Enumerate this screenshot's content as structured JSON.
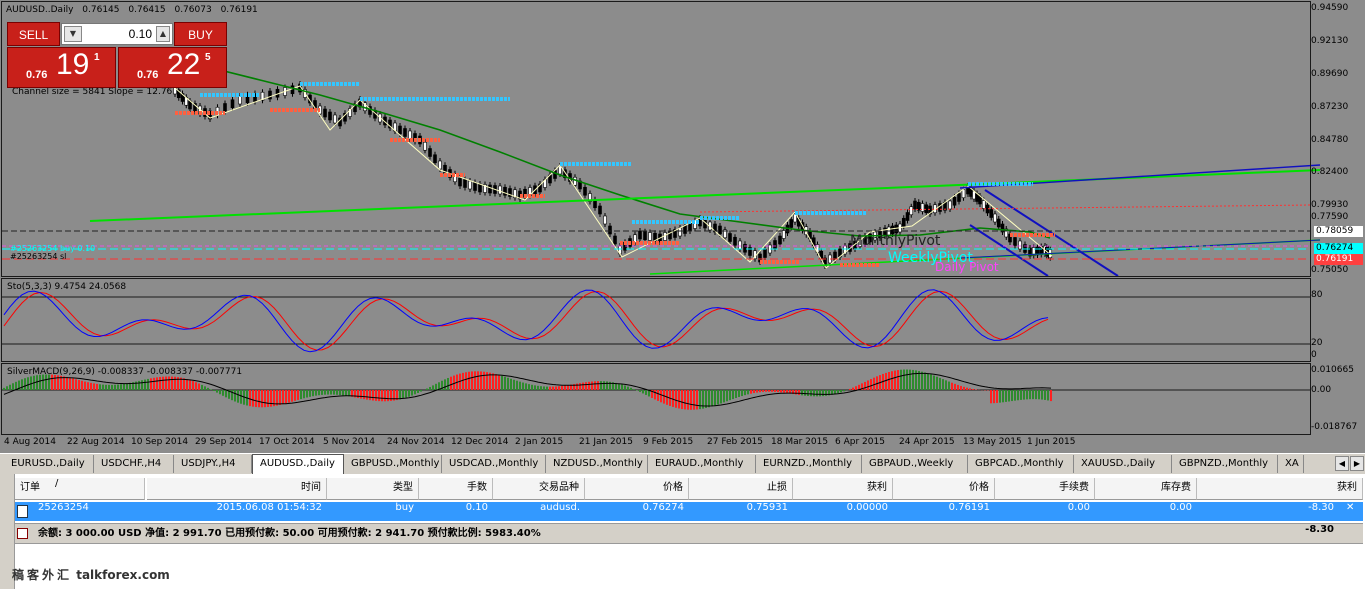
{
  "chart": {
    "symbol_label": "AUDUSD..Daily",
    "ohlc": [
      "0.76145",
      "0.76415",
      "0.76073",
      "0.76191"
    ],
    "channel_info": "Channel size = 5841  Slope = 12.76",
    "stoch_label": "Sto(5,3,3) 9.4754 24.0568",
    "macd_label": "SilverMACD(9,26,9) -0.008337 -0.008337 -0.007771",
    "order_line_1": "#25263254 buy 0.10",
    "order_line_2": "#25263254 sl",
    "pivot_monthly": "MonthlyPivot",
    "pivot_weekly": "WeeklyPivot",
    "pivot_daily": "Daily Pivot",
    "price_axis": [
      "0.94590",
      "0.92130",
      "0.89690",
      "0.87230",
      "0.84780",
      "0.82400",
      "0.79930",
      "0.77590",
      "0.75050"
    ],
    "price_tags": [
      {
        "label": "0.78059",
        "bg": "#ffffff",
        "fg": "#000000"
      },
      {
        "label": "0.76274",
        "bg": "#00ffff",
        "fg": "#000000"
      },
      {
        "label": "0.76191",
        "bg": "#ff4040",
        "fg": "#ffffff"
      }
    ],
    "stoch_axis": [
      "80",
      "20",
      "0"
    ],
    "macd_axis": [
      "0.010665",
      "0.00",
      "-0.018767"
    ],
    "date_axis": [
      "4 Aug 2014",
      "22 Aug 2014",
      "10 Sep 2014",
      "29 Sep 2014",
      "17 Oct 2014",
      "5 Nov 2014",
      "24 Nov 2014",
      "12 Dec 2014",
      "2 Jan 2015",
      "21 Jan 2015",
      "9 Feb 2015",
      "27 Feb 2015",
      "18 Mar 2015",
      "6 Apr 2015",
      "24 Apr 2015",
      "13 May 2015",
      "1 Jun 2015"
    ],
    "colors": {
      "bg": "#8c8c8c",
      "ma": "#008000",
      "channel": "#00e000",
      "resist": "#33c6ff",
      "support": "#ff6040",
      "macd_pos": "#2e8b2e",
      "macd_neg": "#ff2020",
      "stoch_k": "#0000ff",
      "stoch_d": "#ff0000",
      "bear_channel": "#1010c0"
    }
  },
  "trade_panel": {
    "sell_label": "SELL",
    "buy_label": "BUY",
    "lot": "0.10",
    "sell_small": "0.76",
    "sell_big": "19",
    "sell_sup": "1",
    "buy_small": "0.76",
    "buy_big": "22",
    "buy_sup": "5"
  },
  "tabs": [
    "EURUSD.,Daily",
    "USDCHF.,H4",
    "USDJPY.,H4",
    "AUDUSD.,Daily",
    "GBPUSD.,Monthly",
    "USDCAD.,Monthly",
    "NZDUSD.,Monthly",
    "EURAUD.,Monthly",
    "EURNZD.,Monthly",
    "GBPAUD.,Weekly",
    "GBPCAD.,Monthly",
    "XAUUSD.,Daily",
    "GBPNZD.,Monthly",
    "XA"
  ],
  "active_tab": "AUDUSD.,Daily",
  "terminal": {
    "headers": [
      "订单",
      "/",
      "时间",
      "类型",
      "手数",
      "交易品种",
      "价格",
      "止损",
      "获利",
      "价格",
      "手续费",
      "库存费",
      "获利"
    ],
    "order": {
      "ticket": "25263254",
      "time": "2015.06.08 01:54:32",
      "type": "buy",
      "lots": "0.10",
      "symbol": "audusd.",
      "open_price": "0.76274",
      "sl": "0.75931",
      "tp": "0.00000",
      "price": "0.76191",
      "commission": "0.00",
      "swap": "0.00",
      "profit": "-8.30"
    },
    "balance_line": "余额: 3 000.00 USD  净值: 2 991.70  已用预付款: 50.00  可用预付款: 2 941.70  预付款比例: 5983.40%",
    "balance_profit": "-8.30"
  },
  "watermark": {
    "cn": "稿客外汇",
    "site": "talkforex.com"
  }
}
